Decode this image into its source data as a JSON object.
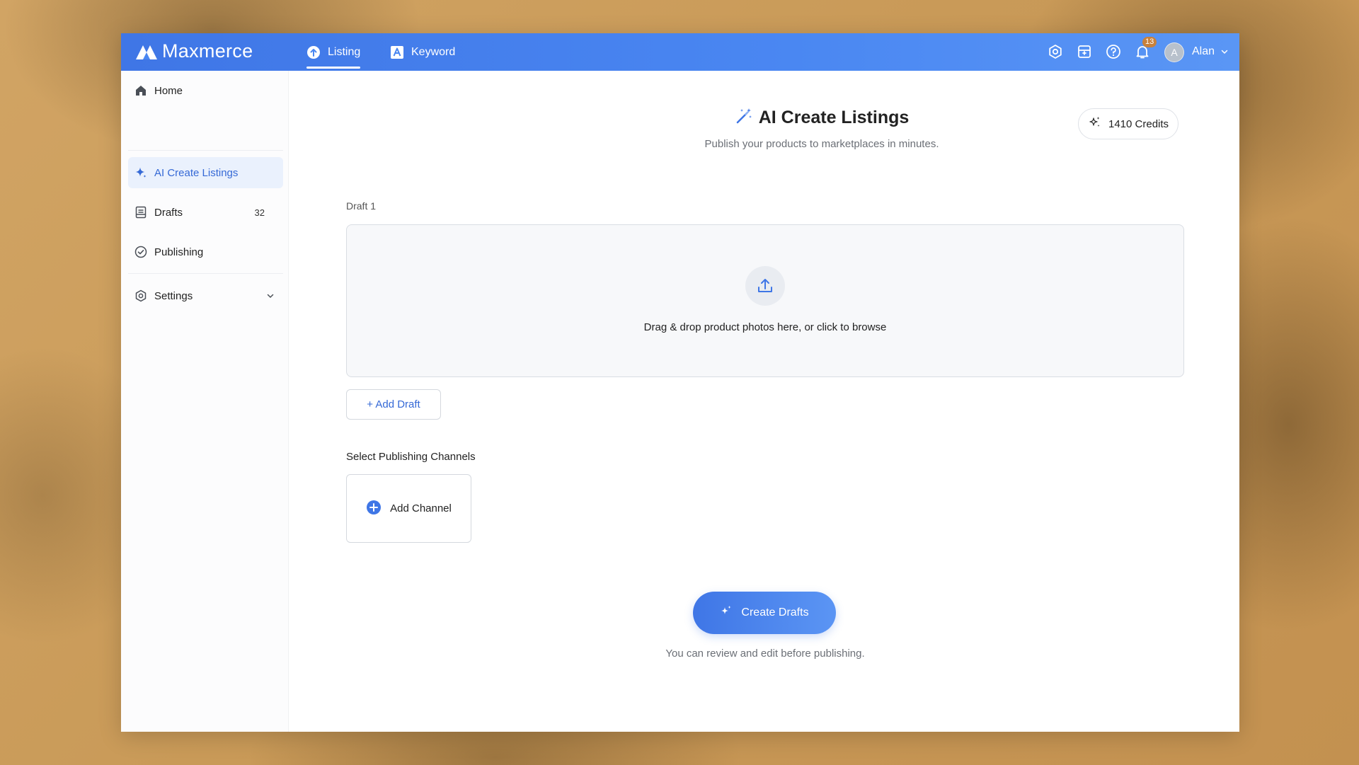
{
  "app": {
    "name": "Maxmerce"
  },
  "topnav": {
    "tabs": [
      {
        "label": "Listing",
        "icon": "upload-circle-icon",
        "active": true
      },
      {
        "label": "Keyword",
        "icon": "keyword-a-icon",
        "active": false
      }
    ],
    "icons": [
      "settings-icon",
      "store-icon",
      "help-icon",
      "bell-icon"
    ],
    "notification_count": "13",
    "user": {
      "initial": "A",
      "name": "Alan"
    }
  },
  "sidebar": {
    "items": [
      {
        "label": "Home",
        "icon": "home-icon"
      },
      {
        "label": "AI Create Listings",
        "icon": "sparkle-icon",
        "active": true
      },
      {
        "label": "Drafts",
        "icon": "drafts-icon",
        "count": "32"
      },
      {
        "label": "Publishing",
        "icon": "check-circle-icon"
      },
      {
        "label": "Settings",
        "icon": "settings-icon",
        "expandable": true
      }
    ]
  },
  "main": {
    "title": "AI Create Listings",
    "subtitle": "Publish your products to marketplaces in minutes.",
    "credits": "1410 Credits",
    "draft_label": "Draft 1",
    "dropzone_text": "Drag & drop product photos here, or click to browse",
    "add_draft": "+ Add Draft",
    "channels_label": "Select Publishing Channels",
    "add_channel": "Add Channel",
    "create_button": "Create Drafts",
    "footnote": "You can review and edit before publishing."
  },
  "colors": {
    "accent": "#3f76e6",
    "active_bg": "#eaf1fd",
    "badge": "#c9813b",
    "background_wood": "#c99a58"
  }
}
